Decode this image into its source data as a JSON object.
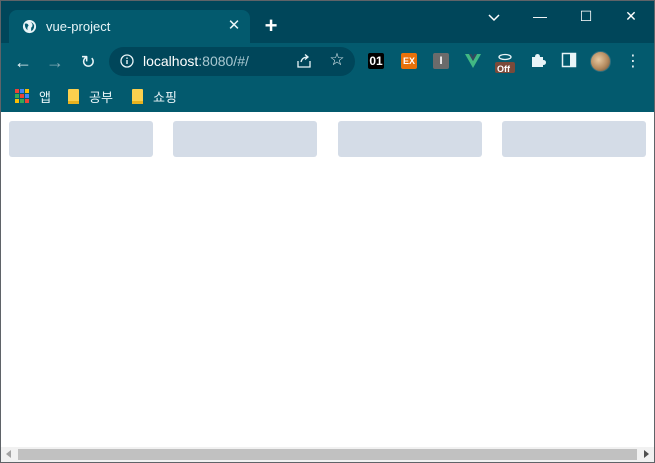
{
  "window": {
    "tab_title": "vue-project",
    "close_tab_glyph": "✕",
    "new_tab_glyph": "+",
    "minimize_glyph": "—",
    "maximize_glyph": "☐",
    "close_glyph": "✕"
  },
  "toolbar": {
    "back_glyph": "←",
    "forward_glyph": "→",
    "reload_glyph": "↻",
    "url_host": "localhost",
    "url_rest": ":8080/#/",
    "star_glyph": "☆",
    "menu_glyph": "⋮",
    "extensions": {
      "ext1_label": "01",
      "ext2_label": "EX",
      "ext3_label": "I",
      "ext5_label": "Off"
    }
  },
  "bookmarks": [
    {
      "label": "앱",
      "icon": "apps-grid-icon"
    },
    {
      "label": "공부",
      "icon": "folder-icon"
    },
    {
      "label": "쇼핑",
      "icon": "folder-icon"
    }
  ],
  "content": {
    "cards": [
      {
        "text": ""
      },
      {
        "text": ""
      },
      {
        "text": ""
      },
      {
        "text": ""
      }
    ]
  },
  "colors": {
    "titlebar": "#00465a",
    "toolbar": "#035a6e",
    "card_placeholder": "#d4dce7",
    "scroll_thumb": "#c1c1c1"
  }
}
